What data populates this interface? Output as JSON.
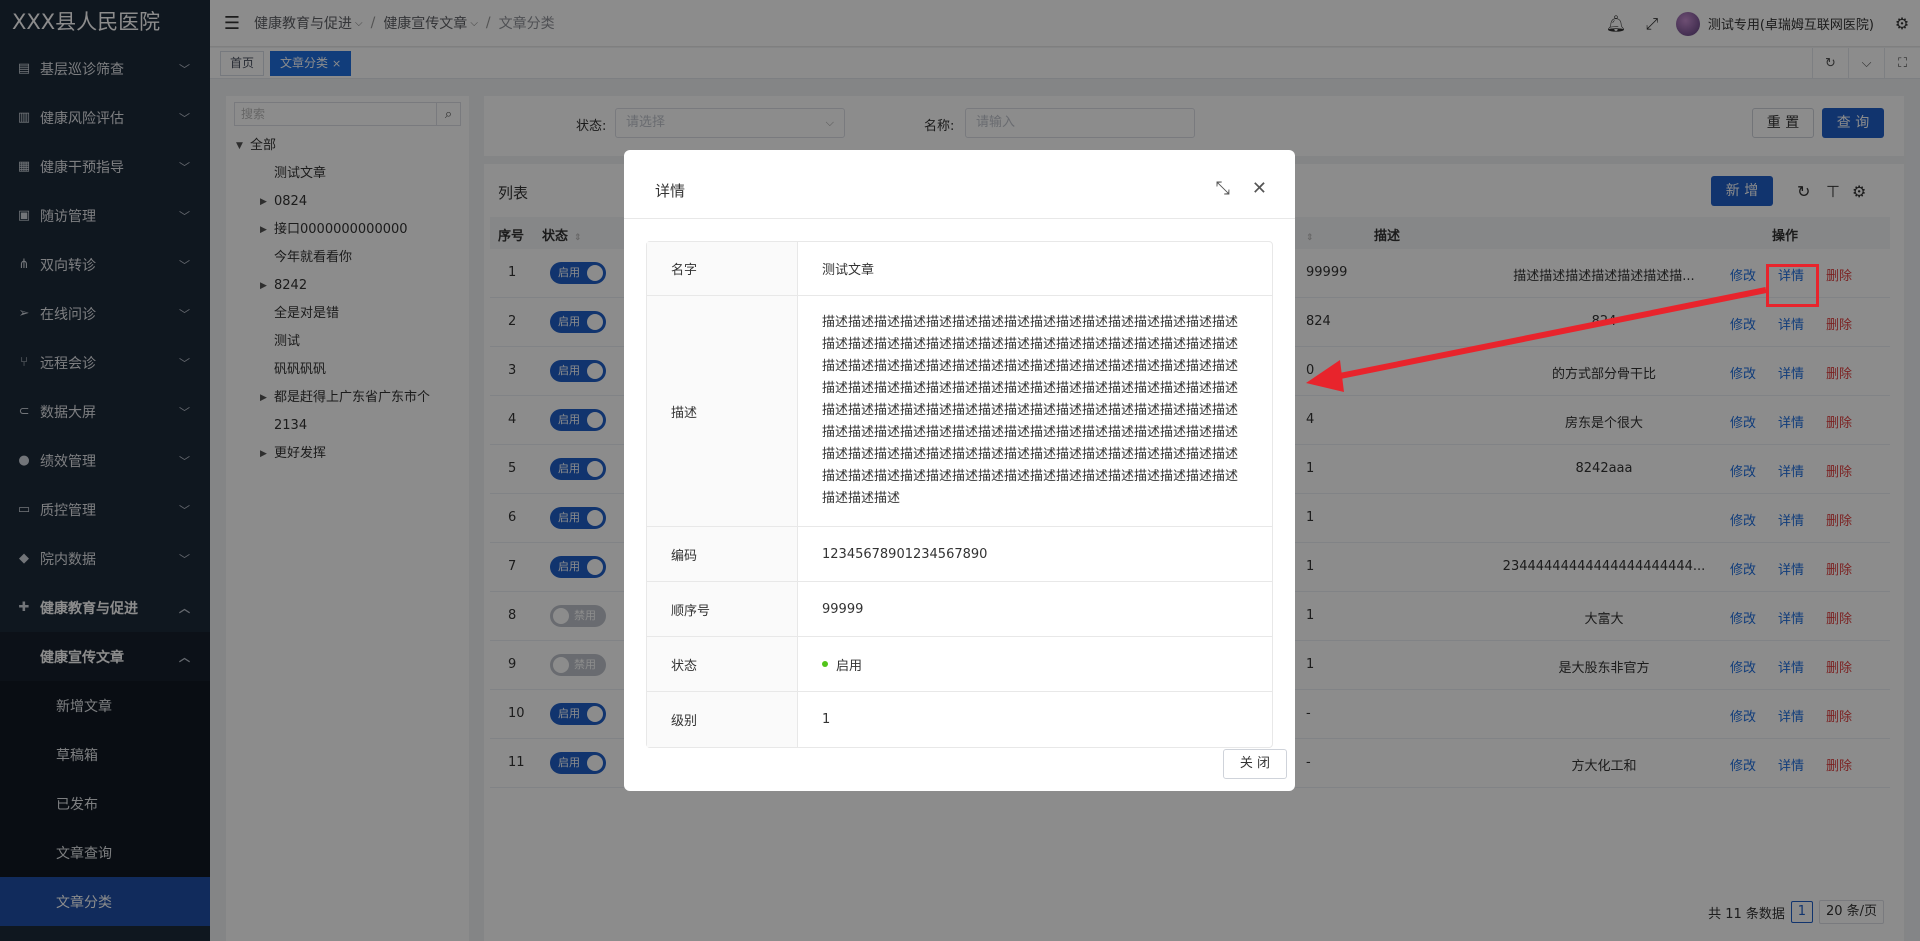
{
  "app": {
    "title": "XXX县人民医院"
  },
  "sidebar": {
    "items": [
      {
        "label": "基层巡诊筛查",
        "icon": "checklist-icon"
      },
      {
        "label": "健康风险评估",
        "icon": "layout-icon"
      },
      {
        "label": "健康干预指导",
        "icon": "grid-table-icon"
      },
      {
        "label": "随访管理",
        "icon": "dashboard-icon"
      },
      {
        "label": "双向转诊",
        "icon": "network-icon"
      },
      {
        "label": "在线问诊",
        "icon": "send-icon"
      },
      {
        "label": "远程会诊",
        "icon": "branch-icon"
      },
      {
        "label": "数据大屏",
        "icon": "link-icon"
      },
      {
        "label": "绩效管理",
        "icon": "circle-icon"
      },
      {
        "label": "质控管理",
        "icon": "laptop-icon"
      },
      {
        "label": "院内数据",
        "icon": "dropbox-icon"
      },
      {
        "label": "健康教育与促进",
        "icon": "plus-grid-icon"
      }
    ],
    "sub_group": "健康宣传文章",
    "sub_items": [
      "新增文章",
      "草稿箱",
      "已发布",
      "文章查询",
      "文章分类"
    ]
  },
  "header": {
    "breadcrumb": [
      "健康教育与促进",
      "健康宣传文章",
      "文章分类"
    ],
    "user_name": "测试专用(卓瑞姆互联网医院)"
  },
  "tags": {
    "home": "首页",
    "current": "文章分类"
  },
  "tree": {
    "search_placeholder": "搜索",
    "nodes": [
      {
        "label": "全部",
        "level": 0,
        "expanded": true
      },
      {
        "label": "测试文章",
        "level": 1,
        "has_children": false
      },
      {
        "label": "0824",
        "level": 1,
        "has_children": true
      },
      {
        "label": "接口0000000000000",
        "level": 1,
        "has_children": true
      },
      {
        "label": "今年就看看你",
        "level": 1,
        "has_children": false
      },
      {
        "label": "8242",
        "level": 1,
        "has_children": true
      },
      {
        "label": "全是对是错",
        "level": 1,
        "has_children": false
      },
      {
        "label": "测试",
        "level": 1,
        "has_children": false
      },
      {
        "label": "矾矾矾矾",
        "level": 1,
        "has_children": false
      },
      {
        "label": "都是赶得上广东省广东市个",
        "level": 1,
        "has_children": true
      },
      {
        "label": "2134",
        "level": 1,
        "has_children": false
      },
      {
        "label": "更好发挥",
        "level": 1,
        "has_children": true
      }
    ]
  },
  "filter": {
    "status_label": "状态:",
    "status_placeholder": "请选择",
    "name_label": "名称:",
    "name_placeholder": "请输入",
    "reset": "重 置",
    "query": "查 询"
  },
  "list": {
    "title": "列表",
    "add": "新 增",
    "columns": {
      "index": "序号",
      "status": "状态",
      "order": "序号",
      "desc": "描述",
      "ops": "操作"
    },
    "actions": {
      "edit": "修改",
      "detail": "详情",
      "delete": "删除"
    },
    "rows": [
      {
        "idx": "1",
        "status": "启用",
        "on": true,
        "order": "99999",
        "desc": "描述描述描述描述描述描述描..."
      },
      {
        "idx": "2",
        "status": "启用",
        "on": true,
        "order": "824",
        "desc": "824"
      },
      {
        "idx": "3",
        "status": "启用",
        "on": true,
        "order": "0",
        "desc": "的方式部分骨干比"
      },
      {
        "idx": "4",
        "status": "启用",
        "on": true,
        "order": "4",
        "desc": "房东是个很大"
      },
      {
        "idx": "5",
        "status": "启用",
        "on": true,
        "order": "1",
        "desc": "8242aaa"
      },
      {
        "idx": "6",
        "status": "启用",
        "on": true,
        "order": "1",
        "desc": ""
      },
      {
        "idx": "7",
        "status": "启用",
        "on": true,
        "order": "1",
        "desc": "23444444444444444444444..."
      },
      {
        "idx": "8",
        "status": "禁用",
        "on": false,
        "order": "1",
        "desc": "大富大"
      },
      {
        "idx": "9",
        "status": "禁用",
        "on": false,
        "order": "1",
        "desc": "是大股东非官方"
      },
      {
        "idx": "10",
        "status": "启用",
        "on": true,
        "order": "-",
        "desc": ""
      },
      {
        "idx": "11",
        "status": "启用",
        "on": true,
        "order": "-",
        "desc": "方大化工和"
      }
    ],
    "pagination": {
      "total_text": "共 11 条数据",
      "current_page": "1",
      "page_size": "20 条/页"
    }
  },
  "modal": {
    "title": "详情",
    "fields": [
      {
        "label": "名字",
        "value": "测试文章"
      },
      {
        "label": "描述",
        "value": "描述描述描述描述描述描述描述描述描述描述描述描述描述描述描述描述描述描述描述描述描述描述描述描述描述描述描述描述描述描述描述描述描述描述描述描述描述描述描述描述描述描述描述描述描述描述描述描述描述描述描述描述描述描述描述描述描述描述描述描述描述描述描述描述描述描述描述描述描述描述描述描述描述描述描述描述描述描述描述描述描述描述描述描述描述描述描述描述描述描述描述描述描述描述描述描述描述描述描述描述描述描述描述描述描述描述描述描述描述描述描述描述描述描述描述描述描述描述描述描述描述描述描述描述描述描述描述描述描述描述描述"
      },
      {
        "label": "编码",
        "value": "12345678901234567890"
      },
      {
        "label": "顺序号",
        "value": "99999"
      },
      {
        "label": "状态",
        "value": "启用"
      },
      {
        "label": "级别",
        "value": "1"
      }
    ],
    "close": "关 闭"
  },
  "colors": {
    "sidebar_bg": "#1d2a3a",
    "primary": "#1f5fc8",
    "danger": "#e04040",
    "annotation": "#e8242c",
    "status_dot": "#52c41a"
  }
}
